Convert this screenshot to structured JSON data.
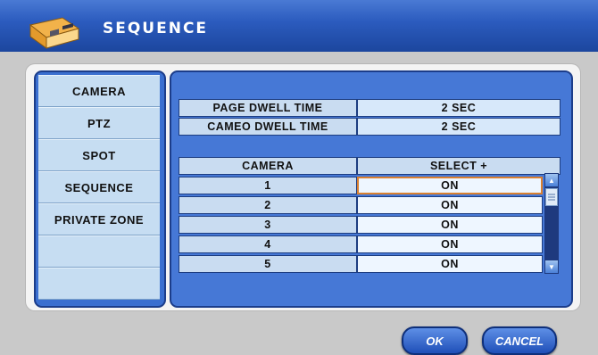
{
  "window": {
    "title": "SEQUENCE",
    "icon": "dvr-device-icon"
  },
  "menu": {
    "items": [
      {
        "label": "CAMERA"
      },
      {
        "label": "PTZ"
      },
      {
        "label": "SPOT"
      },
      {
        "label": "SEQUENCE"
      },
      {
        "label": "PRIVATE ZONE"
      },
      {
        "label": ""
      },
      {
        "label": ""
      }
    ]
  },
  "settings": {
    "page_dwell": {
      "label": "PAGE DWELL TIME",
      "value": "2 SEC"
    },
    "cameo_dwell": {
      "label": "CAMEO DWELL TIME",
      "value": "2 SEC"
    }
  },
  "table": {
    "headers": [
      "CAMERA",
      "SELECT +"
    ],
    "rows": [
      {
        "camera": "1",
        "select": "ON",
        "selected": true
      },
      {
        "camera": "2",
        "select": "ON"
      },
      {
        "camera": "3",
        "select": "ON"
      },
      {
        "camera": "4",
        "select": "ON"
      },
      {
        "camera": "5",
        "select": "ON"
      }
    ]
  },
  "buttons": {
    "ok": "OK",
    "cancel": "CANCEL"
  },
  "colors": {
    "titlebar": "#2c5cbf",
    "panel": "#4678d6",
    "selection": "#d98030"
  }
}
